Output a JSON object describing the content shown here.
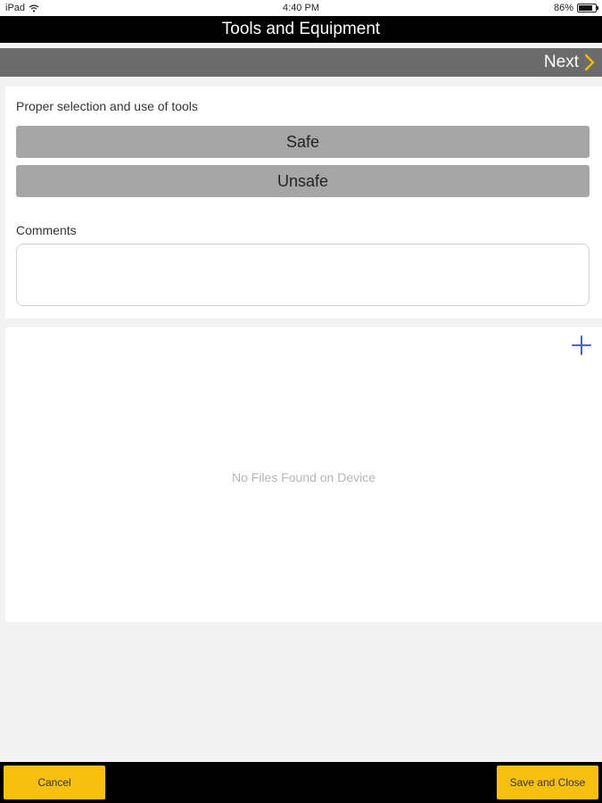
{
  "status_bar": {
    "device": "iPad",
    "wifi_icon": "wifi-icon",
    "time": "4:40 PM",
    "battery": "86%",
    "battery_icon": "battery-icon"
  },
  "header": {
    "title": "Tools and Equipment"
  },
  "nav": {
    "next_label": "Next",
    "next_icon": "chevron-right-icon",
    "accent_color": "#f5b800"
  },
  "form": {
    "question": "Proper selection and use of tools",
    "options": [
      "Safe",
      "Unsafe"
    ],
    "comments_label": "Comments",
    "comments_value": ""
  },
  "files": {
    "add_icon": "plus-icon",
    "empty_message": "No Files Found on Device"
  },
  "footer": {
    "cancel_label": "Cancel",
    "save_label": "Save and Close",
    "button_color": "#f7bf0e"
  }
}
